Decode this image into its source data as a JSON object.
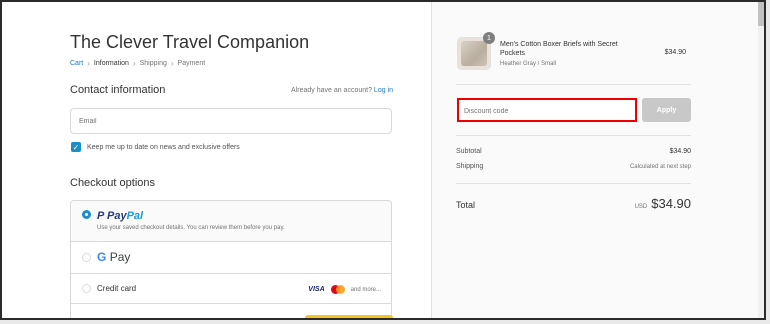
{
  "store": {
    "title": "The Clever Travel Companion"
  },
  "breadcrumb": [
    "Cart",
    "Information",
    "Shipping",
    "Payment"
  ],
  "contact": {
    "title": "Contact information",
    "account_prompt": "Already have an account?",
    "login": "Log in",
    "email_placeholder": "Email",
    "newsletter_label": "Keep me up to date on news and exclusive offers"
  },
  "checkout": {
    "title": "Checkout options",
    "paypal": {
      "logo_p1": "Pay",
      "logo_p2": "Pal",
      "desc": "Use your saved checkout details. You can review them before you pay."
    },
    "gpay": {
      "g": "G",
      "text": "Pay"
    },
    "credit": {
      "label": "Credit card",
      "visa": "VISA",
      "more": "and more..."
    }
  },
  "summary": {
    "product": {
      "name": "Men's Cotton Boxer Briefs with Secret Pockets",
      "variant": "Heather Gray / Small",
      "price": "$34.90",
      "quantity": "1"
    },
    "discount_placeholder": "Discount code",
    "apply_label": "Apply",
    "subtotal_label": "Subtotal",
    "subtotal_value": "$34.90",
    "shipping_label": "Shipping",
    "shipping_value": "Calculated at next step",
    "total_label": "Total",
    "total_currency": "USD",
    "total_value": "$34.90"
  },
  "colors": {
    "accent": "#1990c6",
    "highlight": "#e00000",
    "button": "#f3c623"
  }
}
